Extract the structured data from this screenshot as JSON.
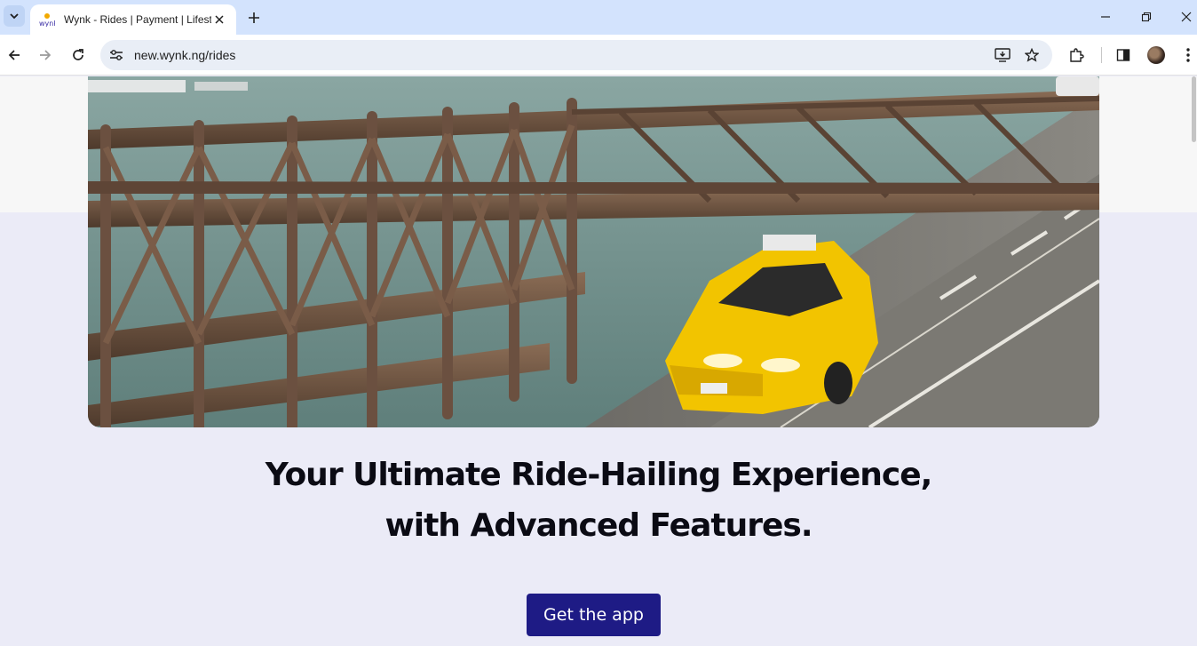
{
  "browser": {
    "tab_title": "Wynk - Rides | Payment | Lifesty",
    "url": "new.wynk.ng/rides",
    "favicon_icon": "wynk-logo-icon",
    "favicon_text": "wynk",
    "icons": {
      "tab_search": "chevron-down-icon",
      "tab_close": "close-icon",
      "new_tab": "plus-icon",
      "minimize": "minimize-icon",
      "restore": "restore-icon",
      "close_window": "close-icon",
      "back": "arrow-left-icon",
      "forward": "arrow-right-icon",
      "reload": "reload-icon",
      "site_info": "tune-icon",
      "install": "install-app-icon",
      "bookmark": "star-icon",
      "extensions": "puzzle-icon",
      "side_panel": "side-panel-icon",
      "menu": "more-vertical-icon"
    }
  },
  "hero": {
    "image_icon": "bridge-taxi-photo",
    "headline_line1": "Your Ultimate Ride-Hailing Experience,",
    "headline_line2": "with Advanced Features.",
    "cta_label": "Get the app"
  },
  "colors": {
    "tabbar": "#d3e3fd",
    "page_bg": "#ebebf7",
    "cta_bg": "#1e1b85",
    "taxi_yellow": "#f2c400"
  }
}
